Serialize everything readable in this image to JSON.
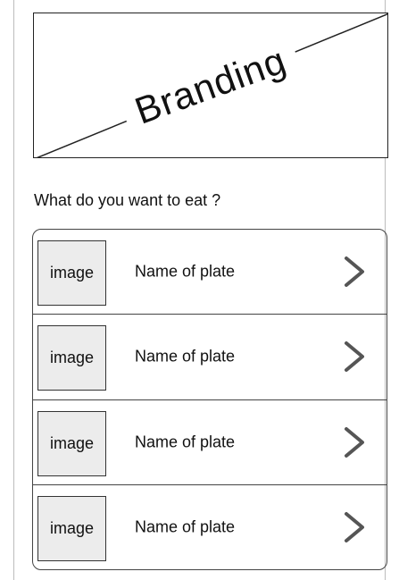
{
  "branding": {
    "label": "Branding"
  },
  "question": "What do you want to eat ?",
  "plates": [
    {
      "image_label": "image",
      "name": "Name of plate",
      "icon": "chevron-right-icon"
    },
    {
      "image_label": "image",
      "name": "Name of plate",
      "icon": "chevron-right-icon"
    },
    {
      "image_label": "image",
      "name": "Name of plate",
      "icon": "chevron-right-icon"
    },
    {
      "image_label": "image",
      "name": "Name of plate",
      "icon": "chevron-right-icon"
    }
  ],
  "colors": {
    "line": "#222222",
    "placeholder_fill": "#ececec",
    "chevron": "#555555"
  }
}
